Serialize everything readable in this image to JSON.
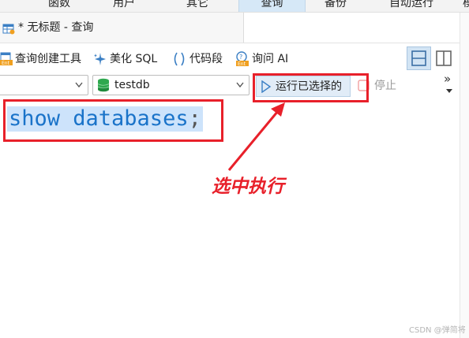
{
  "menubar": {
    "items": [
      {
        "label": "函数",
        "active": false
      },
      {
        "label": "用户",
        "active": false
      },
      {
        "label": "其它",
        "active": false
      },
      {
        "label": "查询",
        "active": true
      },
      {
        "label": "备份",
        "active": false
      },
      {
        "label": "自动运行",
        "active": false
      },
      {
        "label": "模",
        "active": false
      }
    ]
  },
  "tab": {
    "title": "* 无标题 - 查询"
  },
  "toolbar": {
    "query_builder": "查询创建工具",
    "beautify_sql": "美化 SQL",
    "code_snippet": "代码段",
    "ask_ai": "询问 AI",
    "more": "»"
  },
  "connection": {
    "value": ""
  },
  "database": {
    "value": "testdb"
  },
  "run_button": {
    "label": "运行已选择的"
  },
  "stop_button": {
    "label": "停止"
  },
  "editor": {
    "code_main": "show databases",
    "code_end": ";"
  },
  "annotation": {
    "text": "选中执行"
  },
  "watermark": {
    "text": "CSDN @弹简将"
  },
  "colors": {
    "annotation": "#e8202a",
    "selection": "#cde3fb",
    "code": "#1a73c9",
    "active_menu": "#d6e8f7"
  }
}
